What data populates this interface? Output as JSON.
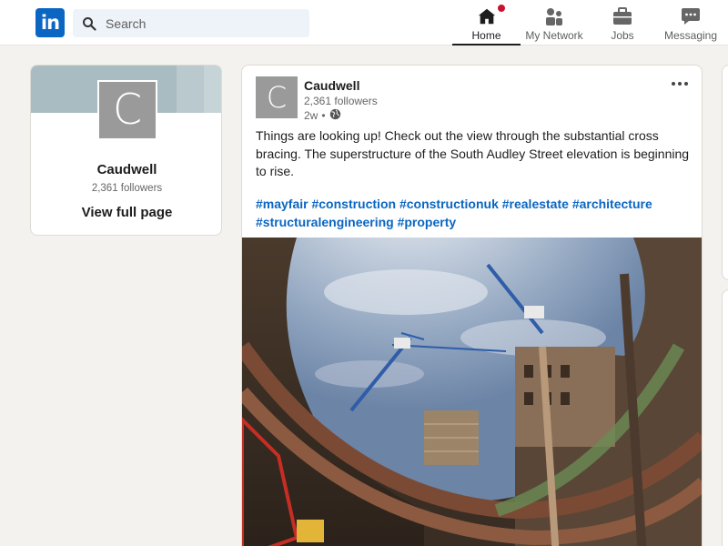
{
  "nav": {
    "logo_text": "in",
    "search_placeholder": "Search",
    "items": [
      {
        "label": "Home",
        "icon": "home-icon",
        "active": true,
        "has_badge": true
      },
      {
        "label": "My Network",
        "icon": "people-icon",
        "active": false
      },
      {
        "label": "Jobs",
        "icon": "briefcase-icon",
        "active": false
      },
      {
        "label": "Messaging",
        "icon": "chat-icon",
        "active": false
      }
    ]
  },
  "company_card": {
    "logo_letter": "C",
    "name": "Caudwell",
    "followers": "2,361 followers",
    "link_label": "View full page"
  },
  "post": {
    "author_logo_letter": "C",
    "author": "Caudwell",
    "followers": "2,361 followers",
    "time": "2w",
    "separator": "•",
    "visibility_icon": "globe-icon",
    "more_icon": "ellipsis-icon",
    "text": "Things are looking up! Check out the view through the substantial cross bracing. The superstructure of the South Audley Street elevation is beginning to rise.",
    "hashtags": [
      "#mayfair",
      "#construction",
      "#constructionuk",
      "#realestate",
      "#architecture",
      "#structuralengineering",
      "#property"
    ],
    "image_icon": "construction-site-photo"
  },
  "colors": {
    "brand": "#0a66c2",
    "badge": "#cb112d",
    "background": "#f4f2ee"
  }
}
